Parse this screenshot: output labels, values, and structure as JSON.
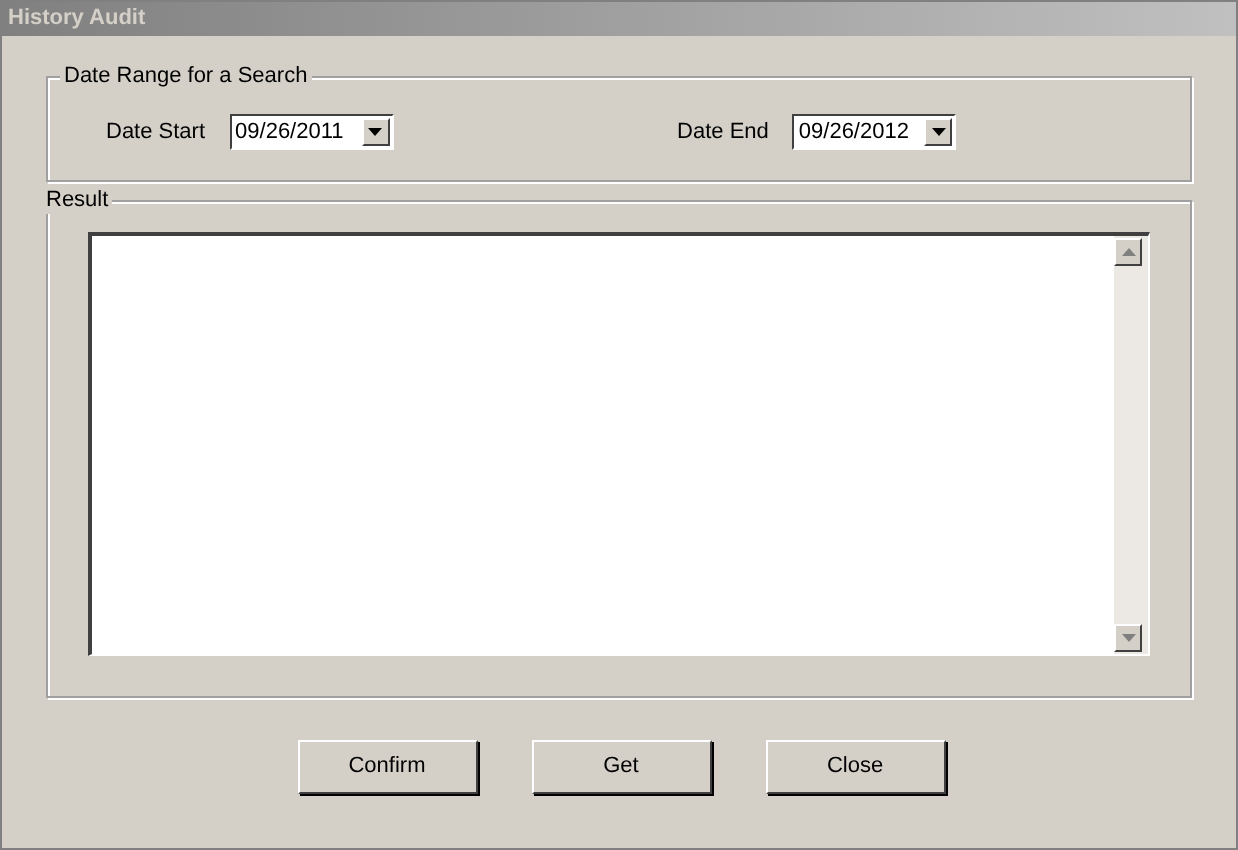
{
  "window": {
    "title": "History Audit"
  },
  "date_range": {
    "title": "Date Range for a Search",
    "fields": [
      {
        "label": "Date Start",
        "value": "09/26/2011"
      },
      {
        "label": "Date End",
        "value": "09/26/2012"
      }
    ]
  },
  "result": {
    "title": "Result"
  },
  "buttons": [
    "Confirm",
    "Get",
    "Close"
  ]
}
